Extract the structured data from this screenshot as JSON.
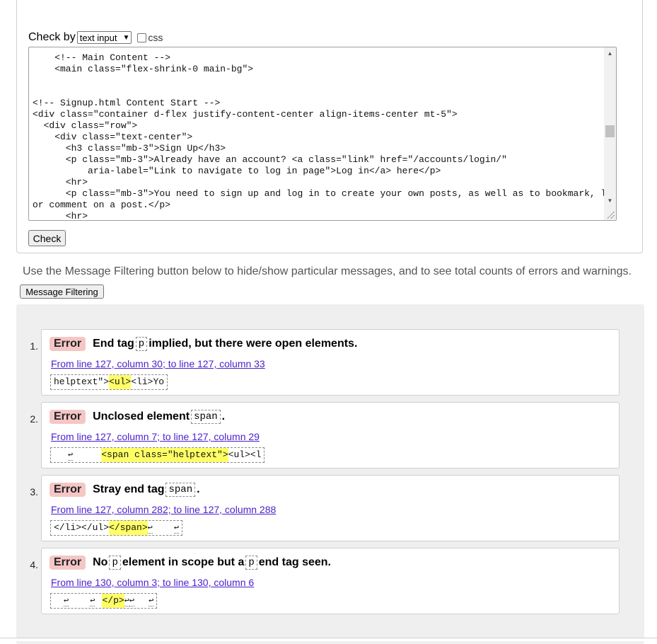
{
  "form": {
    "check_by_label": "Check by",
    "check_by_selected": "text input",
    "css_label": "css",
    "code_lines": [
      "    <!-- Main Content -->",
      "    <main class=\"flex-shrink-0 main-bg\">",
      "",
      "",
      "<!-- Signup.html Content Start -->",
      "<div class=\"container d-flex justify-content-center align-items-center mt-5\">",
      "  <div class=\"row\">",
      "    <div class=\"text-center\">",
      "      <h3 class=\"mb-3\">Sign Up</h3>",
      "      <p class=\"mb-3\">Already have an account? <a class=\"link\" href=\"/accounts/login/\"",
      "          aria-label=\"Link to navigate to log in page\">Log in</a> here</p>",
      "      <hr>",
      "      <p class=\"mb-3\">You need to sign up and log in to create your own posts, as well as to bookmark, like",
      "or comment on a post.</p>",
      "      <hr>"
    ],
    "check_button": "Check"
  },
  "info_text": "Use the Message Filtering button below to hide/show particular messages, and to see total counts of errors and warnings.",
  "filter_button": "Message Filtering",
  "messages": [
    {
      "num": "1.",
      "type": "Error",
      "text_before": "End tag",
      "code": "p",
      "text_after": "implied, but there were open elements.",
      "link": "From line 127, column 30; to line 127, column 33",
      "snippet_pre": "helptext\">",
      "snippet_hl": "<ul>",
      "snippet_post": "<li>Yo"
    },
    {
      "num": "2.",
      "type": "Error",
      "text_before": "Unclosed element",
      "code": "span",
      "text_after": ".",
      "link": "From line 127, column 7; to line 127, column 29",
      "snippet_pre": "",
      "snippet_hl": "<span class=\"helptext\">",
      "snippet_post": "<ul><l"
    },
    {
      "num": "3.",
      "type": "Error",
      "text_before": "Stray end tag",
      "code": "span",
      "text_after": ".",
      "link": "From line 127, column 282; to line 127, column 288",
      "snippet_pre": "</li></ul>",
      "snippet_hl": "</span>",
      "snippet_post": ""
    },
    {
      "num": "4.",
      "type": "Error",
      "text_before": "No",
      "code": "p",
      "text_middle": "element in scope but a",
      "code2": "p",
      "text_after": "end tag seen.",
      "link": "From line 130, column 3; to line 130, column 6",
      "snippet_pre": "",
      "snippet_hl": "</p>",
      "snippet_post": ""
    }
  ],
  "return_glyph": "↩",
  "colors": {
    "error_badge": "#f5c6c6",
    "highlight": "#ffff66",
    "link": "#4a1fcc",
    "panel_bg": "#efefef"
  }
}
